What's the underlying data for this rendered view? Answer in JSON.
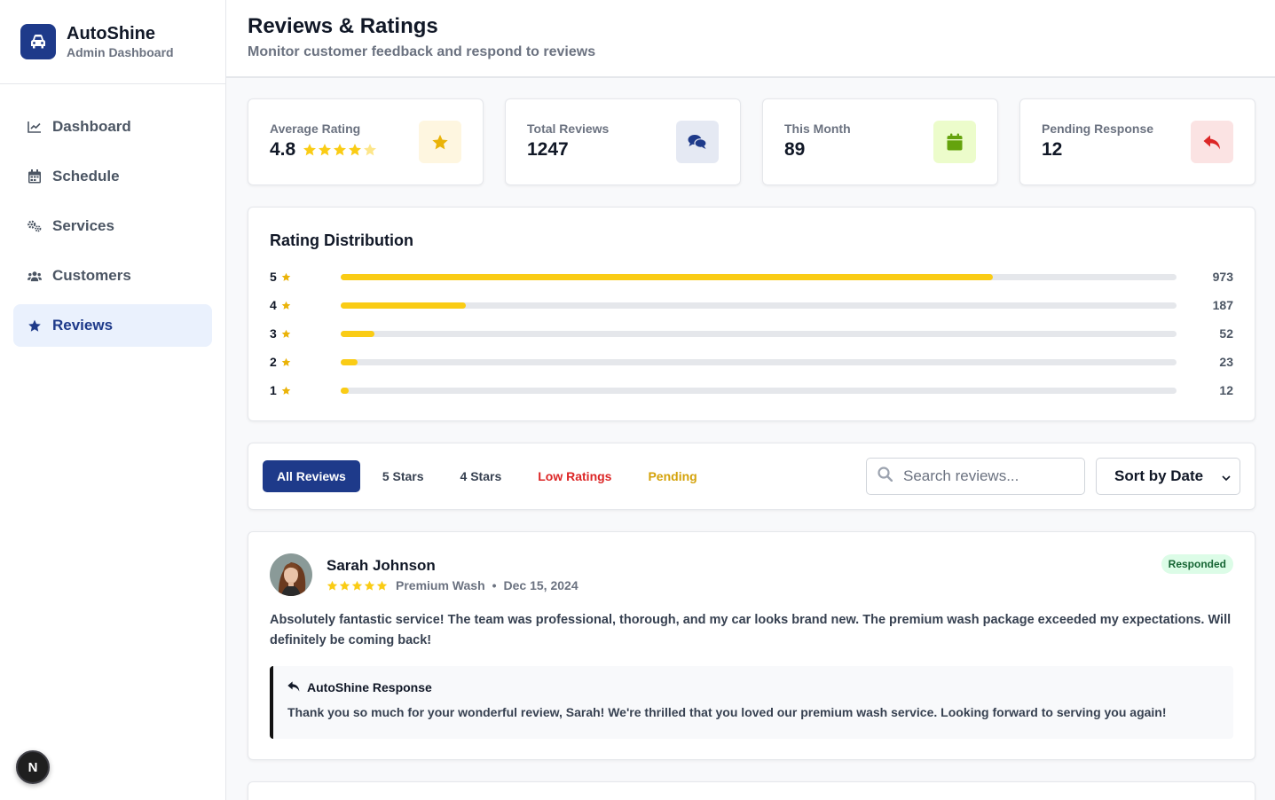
{
  "brand": {
    "name": "AutoShine",
    "subtitle": "Admin Dashboard"
  },
  "nav": [
    {
      "label": "Dashboard",
      "icon": "chart-line-icon"
    },
    {
      "label": "Schedule",
      "icon": "calendar-icon"
    },
    {
      "label": "Services",
      "icon": "gears-icon"
    },
    {
      "label": "Customers",
      "icon": "users-icon"
    },
    {
      "label": "Reviews",
      "icon": "star-icon",
      "active": true
    }
  ],
  "header": {
    "title": "Reviews & Ratings",
    "subtitle": "Monitor customer feedback and respond to reviews"
  },
  "stats": [
    {
      "label": "Average Rating",
      "value": "4.8",
      "rating": 4.8,
      "icon": "star-icon",
      "color": "#eab308"
    },
    {
      "label": "Total Reviews",
      "value": "1247",
      "icon": "comments-icon",
      "color": "#1e3a8a"
    },
    {
      "label": "This Month",
      "value": "89",
      "icon": "calendar-icon",
      "color": "#65a30d"
    },
    {
      "label": "Pending Response",
      "value": "12",
      "icon": "reply-icon",
      "color": "#dc2626"
    }
  ],
  "distribution": {
    "title": "Rating Distribution",
    "rows": [
      {
        "stars": "5",
        "count": "973",
        "fraction": 0.78
      },
      {
        "stars": "4",
        "count": "187",
        "fraction": 0.15
      },
      {
        "stars": "3",
        "count": "52",
        "fraction": 0.04
      },
      {
        "stars": "2",
        "count": "23",
        "fraction": 0.02
      },
      {
        "stars": "1",
        "count": "12",
        "fraction": 0.01
      }
    ]
  },
  "filters": {
    "tabs": [
      "All Reviews",
      "5 Stars",
      "4 Stars",
      "Low Ratings",
      "Pending"
    ],
    "search_placeholder": "Search reviews...",
    "sort_value": "Sort by Date"
  },
  "review": {
    "name": "Sarah Johnson",
    "rating": 5,
    "service": "Premium Wash",
    "date": "Dec 15, 2024",
    "status": "Responded",
    "text": "Absolutely fantastic service! The team was professional, thorough, and my car looks brand new. The premium wash package exceeded my expectations. Will definitely be coming back!",
    "response_title": "AutoShine Response",
    "response_text": "Thank you so much for your wonderful review, Sarah! We're thrilled that you loved our premium wash service. Looking forward to serving you again!"
  },
  "n_badge": "N",
  "colors": {
    "primary": "#1e3a8a",
    "star": "#facc15",
    "success_bg": "#dcfce7"
  }
}
